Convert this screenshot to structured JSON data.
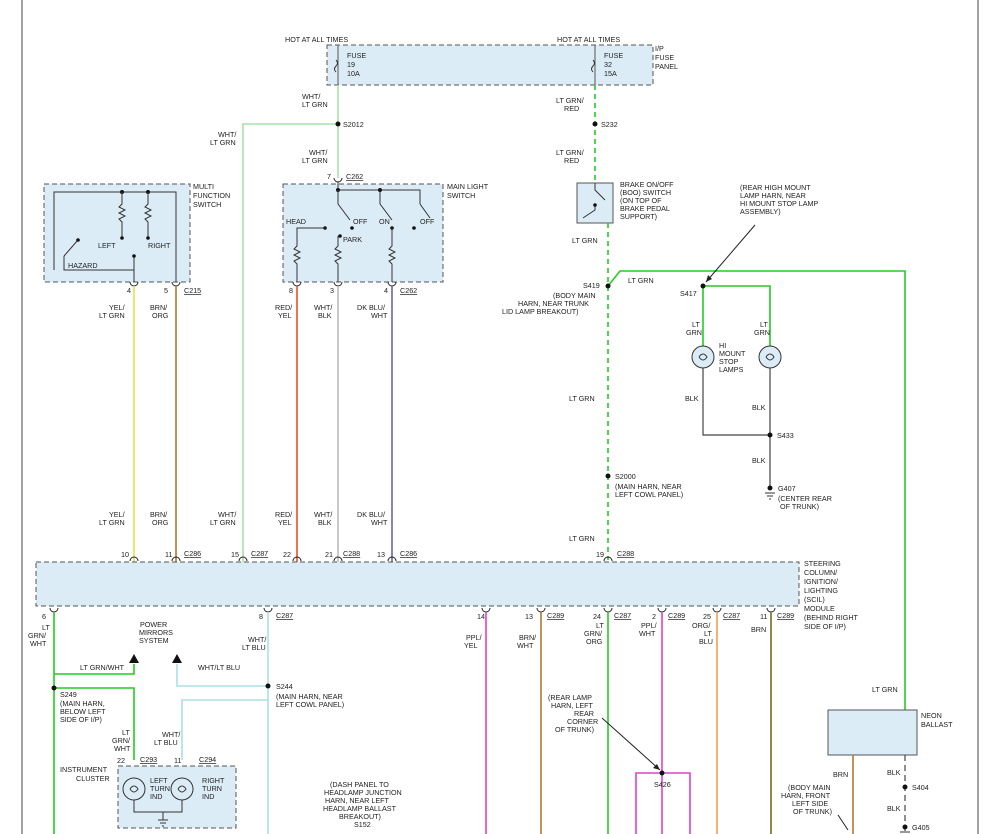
{
  "colors": {
    "lt_grn": "#7de07d",
    "green": "#22cc22",
    "wht": "#bbbbbb",
    "yel": "#d8e84a",
    "brn": "#b07a2a",
    "red": "#e8502a",
    "blu": "#6a64b0",
    "ppl": "#e040d0",
    "org": "#f0a050",
    "lt_blu": "#a8e0e8",
    "box": "#dcecf7"
  },
  "fuse_panel": {
    "hot1": "HOT AT ALL TIMES",
    "hot2": "HOT AT ALL TIMES",
    "fuse1": [
      "FUSE",
      "19",
      "10A"
    ],
    "fuse2": [
      "FUSE",
      "32",
      "15A"
    ],
    "panel": [
      "I/P",
      "FUSE",
      "PANEL"
    ]
  },
  "labels": {
    "wht_ltgrn_1": [
      "WHT/",
      "LT GRN"
    ],
    "wht_ltgrn_2": [
      "WHT/",
      "LT GRN"
    ],
    "wht_ltgrn_3": [
      "WHT/",
      "LT GRN"
    ],
    "wht_ltgrn_4": [
      "WHT/",
      "LT GRN"
    ],
    "s2012": "S2012",
    "ltgrn_red_1": [
      "LT GRN/",
      "RED"
    ],
    "ltgrn_red_2": [
      "LT GRN/",
      "RED"
    ],
    "s232": "S232",
    "multi": [
      "MULTI",
      "FUNCTION",
      "SWITCH"
    ],
    "left": "LEFT",
    "right": "RIGHT",
    "hazard": "HAZARD",
    "main_light": [
      "MAIN LIGHT",
      "SWITCH"
    ],
    "c262a": "C262",
    "c262b": "C262",
    "pin7": "7",
    "head": "HEAD",
    "off1": "OFF",
    "on": "ON",
    "off2": "OFF",
    "park": "PARK",
    "boo": [
      "BRAKE ON/OFF",
      "(BOO) SWITCH",
      "(ON TOP OF",
      "BRAKE PEDAL",
      "SUPPORT)"
    ],
    "lt_grn_1": "LT GRN",
    "lt_grn_2": "LT GRN",
    "lt_grn_3": "LT GRN",
    "lt_grn_4": "LT GRN",
    "lt_grn_5": "LT GRN",
    "rear_high": [
      "(REAR HIGH MOUNT",
      "LAMP HARN, NEAR",
      "HI MOUNT STOP LAMP",
      "ASSEMBLY)"
    ],
    "s419": "S419",
    "s419_desc": [
      "(BODY MAIN",
      "HARN, NEAR TRUNK",
      "LID LAMP BREAKOUT)"
    ],
    "s417": "S417",
    "lamp_ltgrn1": [
      "LT",
      "GRN"
    ],
    "lamp_ltgrn2": [
      "LT",
      "GRN"
    ],
    "hi_mount": [
      "HI",
      "MOUNT",
      "STOP",
      "LAMPS"
    ],
    "blk1": "BLK",
    "blk2": "BLK",
    "blk3": "BLK",
    "blk4": "BLK",
    "blk5": "BLK",
    "s433": "S433",
    "g407": "G407",
    "g407_desc": [
      "(CENTER REAR",
      "OF TRUNK)"
    ],
    "s2000": "S2000",
    "s2000_desc": [
      "(MAIN HARN, NEAR",
      "LEFT COWL PANEL)"
    ],
    "pin4a": "4",
    "pin5": "5",
    "c215": "C215",
    "pin8": "8",
    "pin3": "3",
    "pin4b": "4",
    "yel_ltgrn_1": [
      "YEL/",
      "LT GRN"
    ],
    "yel_ltgrn_2": [
      "YEL/",
      "LT GRN"
    ],
    "brn_org_1": [
      "BRN/",
      "ORG"
    ],
    "brn_org_2": [
      "BRN/",
      "ORG"
    ],
    "red_yel_1": [
      "RED/",
      "YEL"
    ],
    "red_yel_2": [
      "RED/",
      "YEL"
    ],
    "wht_blk_1": [
      "WHT/",
      "BLK"
    ],
    "wht_blk_2": [
      "WHT/",
      "BLK"
    ],
    "dkblu_wht_1": [
      "DK BLU/",
      "WHT"
    ],
    "dkblu_wht_2": [
      "DK BLU/",
      "WHT"
    ],
    "top_pins": [
      "10",
      "11",
      "15",
      "22",
      "21",
      "13",
      "19"
    ],
    "c286a": "C286",
    "c287a": "C287",
    "c288": "C288",
    "c286b": "C286",
    "c288b": "C288",
    "scil": [
      "STEERING",
      "COLUMN/",
      "IGNITION/",
      "LIGHTING",
      "(SCIL)",
      "MODULE",
      "(BEHIND RIGHT",
      "SIDE OF I/P)"
    ],
    "pin6": "6",
    "pin8b": "8",
    "c287b": "C287",
    "lt_grn_wht": [
      "LT",
      "GRN/",
      "WHT"
    ],
    "power_mirrors": [
      "POWER",
      "MIRRORS",
      "SYSTEM"
    ],
    "wht_ltblu_1": [
      "WHT/",
      "LT BLU"
    ],
    "ltgrn_wht_h": "LT GRN/WHT",
    "wht_ltblu_h": "WHT/LT BLU",
    "s249": "S249",
    "s249_desc": [
      "(MAIN HARN,",
      "BELOW LEFT",
      "SIDE OF I/P)"
    ],
    "s244": "S244",
    "s244_desc": [
      "(MAIN HARN, NEAR",
      "LEFT COWL PANEL)"
    ],
    "lt_grn_wht_2": [
      "LT",
      "GRN/",
      "WHT"
    ],
    "wht_ltblu_2": [
      "WHT/",
      "LT BLU"
    ],
    "pin22": "22",
    "c293": "C293",
    "pin11": "11",
    "c294": "C294",
    "instrument": [
      "INSTRUMENT",
      "CLUSTER"
    ],
    "left_turn": [
      "LEFT",
      "TURN",
      "IND"
    ],
    "right_turn": [
      "RIGHT",
      "TURN",
      "IND"
    ],
    "dash": [
      "(DASH PANEL TO",
      "HEADLAMP JUNCTION",
      "HARN, NEAR LEFT",
      "HEADLAMP BALLAST",
      "BREAKOUT)",
      "S152"
    ],
    "bottom_pins": [
      "14",
      "13",
      "24",
      "2",
      "25",
      "11"
    ],
    "c289a": "C289",
    "c287c": "C287",
    "c289b": "C289",
    "c287d": "C287",
    "c289c": "C289",
    "ppl_yel": [
      "PPL/",
      "YEL"
    ],
    "brn_wht": [
      "BRN/",
      "WHT"
    ],
    "lt_grn_org": [
      "LT",
      "GRN/",
      "ORG"
    ],
    "ppl_wht": [
      "PPL/",
      "WHT"
    ],
    "org_lt_blu": [
      "ORG/",
      "LT",
      "BLU"
    ],
    "brn1": "BRN",
    "brn2": "BRN",
    "rear_lamp": [
      "(REAR LAMP",
      "HARN, LEFT",
      "REAR",
      "CORNER",
      "OF TRUNK)"
    ],
    "s426": "S426",
    "neon": [
      "NEON",
      "BALLAST"
    ],
    "s404": "S404",
    "g405": "G405",
    "body_main": [
      "(BODY MAIN",
      "HARN, FRONT",
      "LEFT SIDE",
      "OF TRUNK)"
    ]
  }
}
